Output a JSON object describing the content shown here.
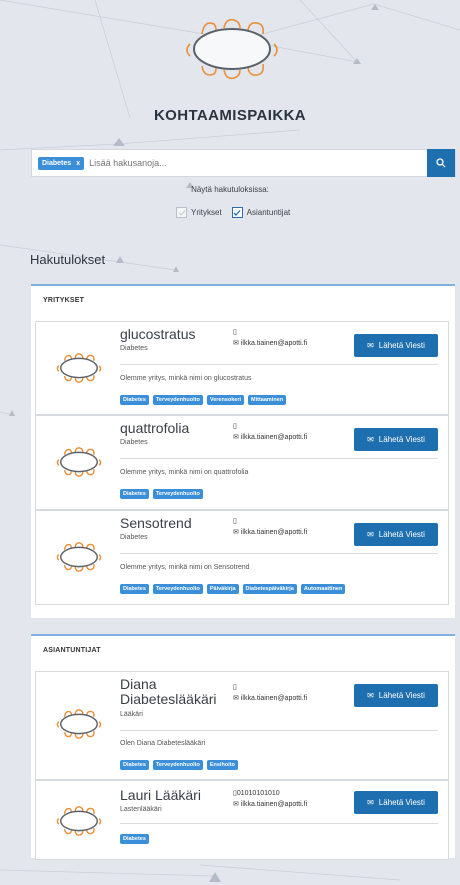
{
  "brand": {
    "name": "KOHTAAMISPAIKKA",
    "logo_icon": "meeting-table-logo",
    "accent": "#e8913a"
  },
  "search": {
    "chip_label": "Diabetes",
    "chip_remove": "x",
    "placeholder": "Lisää hakusanoja...",
    "button_icon": "search-icon"
  },
  "filters": {
    "title": "Näytä hakutuloksissa:",
    "options": [
      {
        "label": "Yritykset",
        "checked": false
      },
      {
        "label": "Asiantuntijat",
        "checked": true
      }
    ]
  },
  "results_title": "Hakutulokset",
  "companies": {
    "title": "YRITYKSET",
    "items": [
      {
        "name": "glucostratus",
        "sub": "Diabetes",
        "phone": "",
        "email": "ilkka.tiainen@apotti.fi",
        "button": "Lähetä Viesti",
        "desc": "Olemme yritys, minkä nimi on glucostratus",
        "tags": [
          "Diabetes",
          "Terveydenhuolto",
          "Verensokeri",
          "Mittaaminen"
        ]
      },
      {
        "name": "quattrofolia",
        "sub": "Diabetes",
        "phone": "",
        "email": "ilkka.tiainen@apotti.fi",
        "button": "Lähetä Viesti",
        "desc": "Olemme yritys, minkä nimi on quattrofolia",
        "tags": [
          "Diabetes",
          "Terveydenhuolto"
        ]
      },
      {
        "name": "Sensotrend",
        "sub": "Diabetes",
        "phone": "",
        "email": "ilkka.tiainen@apotti.fi",
        "button": "Lähetä Viesti",
        "desc": "Olemme yritys, minkä nimi on Sensotrend",
        "tags": [
          "Diabetes",
          "Terveydenhuolto",
          "Päiväkirja",
          "Diabetespäiväkirja",
          "Automaattinen"
        ]
      }
    ]
  },
  "experts": {
    "title": "ASIANTUNTIJAT",
    "items": [
      {
        "name_line1": "Diana",
        "name_line2": "Diabeteslääkäri",
        "sub": "Lääkäri",
        "phone": "",
        "email": "ilkka.tiainen@apotti.fi",
        "button": "Lähetä Viesti",
        "desc": "Olen Diana Diabeteslääkäri",
        "tags": [
          "Diabetes",
          "Terveydenhuolto",
          "Ensihoito"
        ]
      },
      {
        "name": "Lauri Lääkäri",
        "sub": "Lastenlääkäri",
        "phone": "01010101010",
        "email": "ilkka.tiainen@apotti.fi",
        "button": "Lähetä Viesti",
        "tags": [
          "Diabetes"
        ]
      }
    ]
  },
  "icons": {
    "mail": "envelope-icon",
    "phone": "phone-icon",
    "send": "envelope-icon",
    "check": "check-icon"
  }
}
